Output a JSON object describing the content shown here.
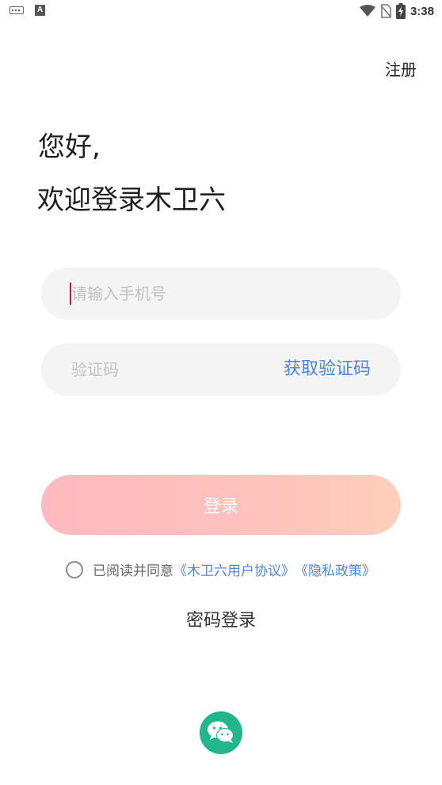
{
  "status_bar": {
    "time": "3:38",
    "icons": [
      "keyboard-icon",
      "a-icon",
      "wifi-icon",
      "no-sim-icon",
      "battery-charging-icon"
    ]
  },
  "header": {
    "register_label": "注册"
  },
  "greeting": {
    "line1": "您好,",
    "line2": "欢迎登录木卫六"
  },
  "form": {
    "phone_placeholder": "请输入手机号",
    "code_placeholder": "验证码",
    "get_code_label": "获取验证码",
    "login_label": "登录"
  },
  "agreement": {
    "prefix": "已阅读并同意",
    "user_agreement": "《木卫六用户协议》",
    "privacy_policy": "《隐私政策》"
  },
  "password_login_label": "密码登录",
  "colors": {
    "accent": "#4a86e0",
    "login_gradient_start": "#ffb9c0",
    "login_gradient_end": "#ffcfba",
    "wechat_green": "#22b68d",
    "field_bg": "#f4f4f5"
  }
}
